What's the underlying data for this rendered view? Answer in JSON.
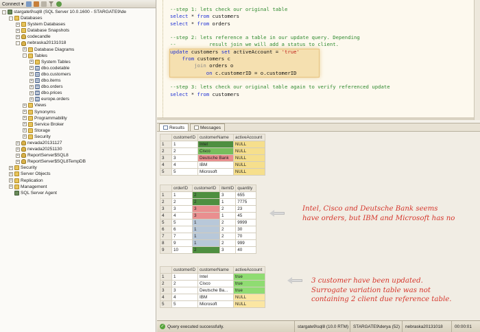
{
  "toolbar": {
    "connect_label": "Connect ▾"
  },
  "tree": [
    {
      "depth": 0,
      "exp": "-",
      "icon": "server",
      "label": "stargate9\\sql8 (SQL Server 10.0.1600 - STARGATE9\\de"
    },
    {
      "depth": 1,
      "exp": "-",
      "icon": "folder",
      "label": "Databases"
    },
    {
      "depth": 2,
      "exp": "+",
      "icon": "folder",
      "label": "System Databases"
    },
    {
      "depth": 2,
      "exp": "+",
      "icon": "folder",
      "label": "Database Snapshots"
    },
    {
      "depth": 2,
      "exp": "+",
      "icon": "db",
      "label": "codecandle"
    },
    {
      "depth": 2,
      "exp": "-",
      "icon": "db",
      "label": "nebraska20131018"
    },
    {
      "depth": 3,
      "exp": "+",
      "icon": "folder",
      "label": "Database Diagrams"
    },
    {
      "depth": 3,
      "exp": "-",
      "icon": "folder",
      "label": "Tables"
    },
    {
      "depth": 4,
      "exp": "+",
      "icon": "folder",
      "label": "System Tables"
    },
    {
      "depth": 4,
      "exp": "+",
      "icon": "table",
      "label": "dbo.codetable"
    },
    {
      "depth": 4,
      "exp": "+",
      "icon": "table",
      "label": "dbo.customers"
    },
    {
      "depth": 4,
      "exp": "+",
      "icon": "table",
      "label": "dbo.items"
    },
    {
      "depth": 4,
      "exp": "+",
      "icon": "table",
      "label": "dbo.orders"
    },
    {
      "depth": 4,
      "exp": "+",
      "icon": "table",
      "label": "dbo.prices"
    },
    {
      "depth": 4,
      "exp": "+",
      "icon": "table",
      "label": "europe.orders"
    },
    {
      "depth": 3,
      "exp": "+",
      "icon": "folder",
      "label": "Views"
    },
    {
      "depth": 3,
      "exp": "+",
      "icon": "folder",
      "label": "Synonyms"
    },
    {
      "depth": 3,
      "exp": "+",
      "icon": "folder",
      "label": "Programmability"
    },
    {
      "depth": 3,
      "exp": "+",
      "icon": "folder",
      "label": "Service Broker"
    },
    {
      "depth": 3,
      "exp": "+",
      "icon": "folder",
      "label": "Storage"
    },
    {
      "depth": 3,
      "exp": "+",
      "icon": "folder",
      "label": "Security"
    },
    {
      "depth": 2,
      "exp": "+",
      "icon": "db",
      "label": "nevada20131127"
    },
    {
      "depth": 2,
      "exp": "+",
      "icon": "db",
      "label": "nevada20251130"
    },
    {
      "depth": 2,
      "exp": "+",
      "icon": "db",
      "label": "ReportServer$SQL8"
    },
    {
      "depth": 2,
      "exp": "+",
      "icon": "db",
      "label": "ReportServer$SQL8TempDB"
    },
    {
      "depth": 1,
      "exp": "+",
      "icon": "folder",
      "label": "Security"
    },
    {
      "depth": 1,
      "exp": "+",
      "icon": "folder",
      "label": "Server Objects"
    },
    {
      "depth": 1,
      "exp": "+",
      "icon": "folder",
      "label": "Replication"
    },
    {
      "depth": 1,
      "exp": "+",
      "icon": "folder",
      "label": "Management"
    },
    {
      "depth": 1,
      "exp": "none",
      "icon": "server",
      "label": "SQL Server Agent"
    }
  ],
  "editor": {
    "lines": [
      [
        [
          "cm",
          "--step 1: lets check our original table"
        ]
      ],
      [
        [
          "kw",
          "select"
        ],
        [
          "",
          " * "
        ],
        [
          "kw",
          "from"
        ],
        [
          "",
          " customers"
        ]
      ],
      [
        [
          "kw",
          "select"
        ],
        [
          "",
          " * "
        ],
        [
          "kw",
          "from"
        ],
        [
          "",
          " orders"
        ]
      ],
      [
        [
          "",
          ""
        ]
      ],
      [
        [
          "cm",
          "--step 2: lets reference a table in our update query. Depending"
        ]
      ],
      [
        [
          "cm",
          "--           result join we will add a status to client."
        ]
      ],
      [
        [
          "kw",
          "update"
        ],
        [
          "",
          " customers "
        ],
        [
          "kw",
          "set"
        ],
        [
          "",
          " activeAccount = "
        ],
        [
          "str",
          "'true'"
        ]
      ],
      [
        [
          "kw",
          "    from"
        ],
        [
          "",
          " customers c"
        ]
      ],
      [
        [
          "gr",
          "        join"
        ],
        [
          "",
          " orders o"
        ]
      ],
      [
        [
          "kw",
          "            on"
        ],
        [
          "",
          " c.customerID = o.customerID"
        ]
      ],
      [
        [
          "",
          ""
        ]
      ],
      [
        [
          "cm",
          "--step 3: lets check our original table again to verify referenced update"
        ]
      ],
      [
        [
          "kw",
          "select"
        ],
        [
          "",
          " * "
        ],
        [
          "kw",
          "from"
        ],
        [
          "",
          " customers"
        ]
      ]
    ]
  },
  "results_tabs": {
    "results": "Results",
    "messages": "Messages"
  },
  "grid1": {
    "headers": [
      "",
      "customerID",
      "customerName",
      "activeAccount"
    ],
    "rows": [
      [
        "1",
        "1",
        "Intel",
        "NULL"
      ],
      [
        "2",
        "2",
        "Cisco",
        "NULL"
      ],
      [
        "3",
        "3",
        "Deutsche Bank",
        "NULL"
      ],
      [
        "4",
        "4",
        "IBM",
        "NULL"
      ],
      [
        "5",
        "5",
        "Microsoft",
        "NULL"
      ]
    ]
  },
  "grid2": {
    "headers": [
      "",
      "orderID",
      "customerID",
      "itemID",
      "quantity"
    ],
    "rows": [
      [
        "1",
        "1",
        "2",
        "3",
        "655"
      ],
      [
        "2",
        "2",
        "2",
        "1",
        "7775"
      ],
      [
        "3",
        "3",
        "3",
        "2",
        "23"
      ],
      [
        "4",
        "4",
        "3",
        "1",
        "45"
      ],
      [
        "5",
        "5",
        "1",
        "2",
        "9999"
      ],
      [
        "6",
        "6",
        "1",
        "2",
        "30"
      ],
      [
        "7",
        "7",
        "1",
        "2",
        "70"
      ],
      [
        "8",
        "9",
        "1",
        "2",
        "999"
      ],
      [
        "9",
        "10",
        "2",
        "3",
        "40"
      ]
    ]
  },
  "grid3": {
    "headers": [
      "",
      "customerID",
      "customerName",
      "activeAccount"
    ],
    "rows": [
      [
        "1",
        "1",
        "Intel",
        "true"
      ],
      [
        "2",
        "2",
        "Cisco",
        "true"
      ],
      [
        "3",
        "3",
        "Deutsche Ba...",
        "true"
      ],
      [
        "4",
        "4",
        "IBM",
        "NULL"
      ],
      [
        "5",
        "5",
        "Microsoft",
        "NULL"
      ]
    ]
  },
  "notes": {
    "note1_line1": "Intel, Cisco and Deutsche Bank seems",
    "note1_line2": "have orders, but IBM and Microsoft has no",
    "note2_line1": "3 customer have been updated.",
    "note2_line2": "Surrogate variation table was not",
    "note2_line3": "containing 2 client due reference table."
  },
  "status": {
    "message": "Query executed successfully.",
    "server": "stargate9\\sql8 (10.0 RTM)",
    "user": "STARGATE9\\derya (52)",
    "database": "nebraska20131018",
    "time": "00:00:01"
  },
  "colors": {
    "accent_yellow": "#f6df8c",
    "note_red": "#d5362c",
    "keyword_blue": "#1d2fd4",
    "comment_green": "#2f8a2f"
  }
}
